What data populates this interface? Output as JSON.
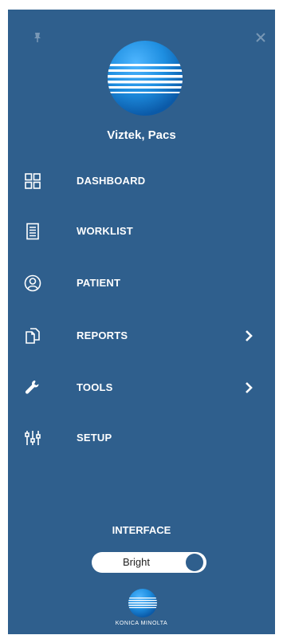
{
  "user": {
    "name": "Viztek, Pacs"
  },
  "nav": {
    "items": [
      {
        "label": "DASHBOARD",
        "icon": "dashboard-grid-icon",
        "has_submenu": false
      },
      {
        "label": "WORKLIST",
        "icon": "worklist-icon",
        "has_submenu": false
      },
      {
        "label": "PATIENT",
        "icon": "patient-icon",
        "has_submenu": false
      },
      {
        "label": "REPORTS",
        "icon": "reports-icon",
        "has_submenu": true
      },
      {
        "label": "TOOLS",
        "icon": "wrench-icon",
        "has_submenu": true
      },
      {
        "label": "SETUP",
        "icon": "sliders-icon",
        "has_submenu": false
      }
    ]
  },
  "interface": {
    "label": "INTERFACE",
    "theme": "Bright"
  },
  "brand": {
    "name": "KONICA MINOLTA"
  },
  "colors": {
    "sidebar_bg": "#2f5f8d",
    "text": "#ffffff",
    "logo_blue": "#1e8ee0"
  }
}
